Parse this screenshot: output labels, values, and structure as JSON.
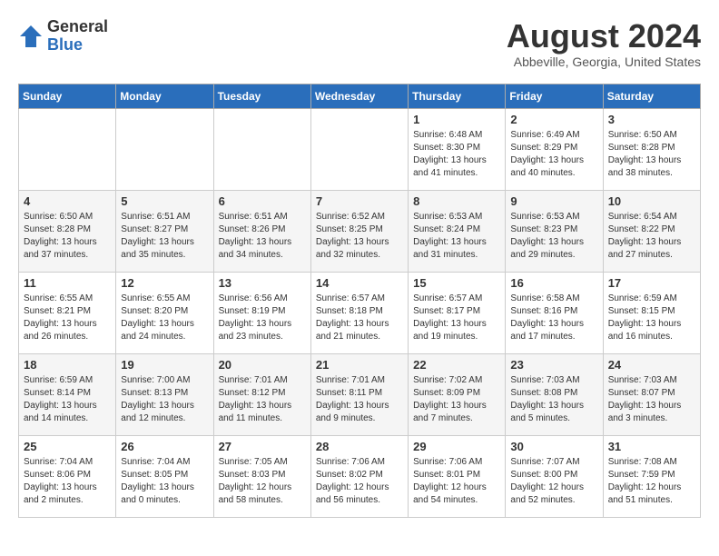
{
  "logo": {
    "general": "General",
    "blue": "Blue"
  },
  "title": "August 2024",
  "location": "Abbeville, Georgia, United States",
  "weekdays": [
    "Sunday",
    "Monday",
    "Tuesday",
    "Wednesday",
    "Thursday",
    "Friday",
    "Saturday"
  ],
  "weeks": [
    [
      {
        "day": "",
        "sunrise": "",
        "sunset": "",
        "daylight": ""
      },
      {
        "day": "",
        "sunrise": "",
        "sunset": "",
        "daylight": ""
      },
      {
        "day": "",
        "sunrise": "",
        "sunset": "",
        "daylight": ""
      },
      {
        "day": "",
        "sunrise": "",
        "sunset": "",
        "daylight": ""
      },
      {
        "day": "1",
        "sunrise": "Sunrise: 6:48 AM",
        "sunset": "Sunset: 8:30 PM",
        "daylight": "Daylight: 13 hours and 41 minutes."
      },
      {
        "day": "2",
        "sunrise": "Sunrise: 6:49 AM",
        "sunset": "Sunset: 8:29 PM",
        "daylight": "Daylight: 13 hours and 40 minutes."
      },
      {
        "day": "3",
        "sunrise": "Sunrise: 6:50 AM",
        "sunset": "Sunset: 8:28 PM",
        "daylight": "Daylight: 13 hours and 38 minutes."
      }
    ],
    [
      {
        "day": "4",
        "sunrise": "Sunrise: 6:50 AM",
        "sunset": "Sunset: 8:28 PM",
        "daylight": "Daylight: 13 hours and 37 minutes."
      },
      {
        "day": "5",
        "sunrise": "Sunrise: 6:51 AM",
        "sunset": "Sunset: 8:27 PM",
        "daylight": "Daylight: 13 hours and 35 minutes."
      },
      {
        "day": "6",
        "sunrise": "Sunrise: 6:51 AM",
        "sunset": "Sunset: 8:26 PM",
        "daylight": "Daylight: 13 hours and 34 minutes."
      },
      {
        "day": "7",
        "sunrise": "Sunrise: 6:52 AM",
        "sunset": "Sunset: 8:25 PM",
        "daylight": "Daylight: 13 hours and 32 minutes."
      },
      {
        "day": "8",
        "sunrise": "Sunrise: 6:53 AM",
        "sunset": "Sunset: 8:24 PM",
        "daylight": "Daylight: 13 hours and 31 minutes."
      },
      {
        "day": "9",
        "sunrise": "Sunrise: 6:53 AM",
        "sunset": "Sunset: 8:23 PM",
        "daylight": "Daylight: 13 hours and 29 minutes."
      },
      {
        "day": "10",
        "sunrise": "Sunrise: 6:54 AM",
        "sunset": "Sunset: 8:22 PM",
        "daylight": "Daylight: 13 hours and 27 minutes."
      }
    ],
    [
      {
        "day": "11",
        "sunrise": "Sunrise: 6:55 AM",
        "sunset": "Sunset: 8:21 PM",
        "daylight": "Daylight: 13 hours and 26 minutes."
      },
      {
        "day": "12",
        "sunrise": "Sunrise: 6:55 AM",
        "sunset": "Sunset: 8:20 PM",
        "daylight": "Daylight: 13 hours and 24 minutes."
      },
      {
        "day": "13",
        "sunrise": "Sunrise: 6:56 AM",
        "sunset": "Sunset: 8:19 PM",
        "daylight": "Daylight: 13 hours and 23 minutes."
      },
      {
        "day": "14",
        "sunrise": "Sunrise: 6:57 AM",
        "sunset": "Sunset: 8:18 PM",
        "daylight": "Daylight: 13 hours and 21 minutes."
      },
      {
        "day": "15",
        "sunrise": "Sunrise: 6:57 AM",
        "sunset": "Sunset: 8:17 PM",
        "daylight": "Daylight: 13 hours and 19 minutes."
      },
      {
        "day": "16",
        "sunrise": "Sunrise: 6:58 AM",
        "sunset": "Sunset: 8:16 PM",
        "daylight": "Daylight: 13 hours and 17 minutes."
      },
      {
        "day": "17",
        "sunrise": "Sunrise: 6:59 AM",
        "sunset": "Sunset: 8:15 PM",
        "daylight": "Daylight: 13 hours and 16 minutes."
      }
    ],
    [
      {
        "day": "18",
        "sunrise": "Sunrise: 6:59 AM",
        "sunset": "Sunset: 8:14 PM",
        "daylight": "Daylight: 13 hours and 14 minutes."
      },
      {
        "day": "19",
        "sunrise": "Sunrise: 7:00 AM",
        "sunset": "Sunset: 8:13 PM",
        "daylight": "Daylight: 13 hours and 12 minutes."
      },
      {
        "day": "20",
        "sunrise": "Sunrise: 7:01 AM",
        "sunset": "Sunset: 8:12 PM",
        "daylight": "Daylight: 13 hours and 11 minutes."
      },
      {
        "day": "21",
        "sunrise": "Sunrise: 7:01 AM",
        "sunset": "Sunset: 8:11 PM",
        "daylight": "Daylight: 13 hours and 9 minutes."
      },
      {
        "day": "22",
        "sunrise": "Sunrise: 7:02 AM",
        "sunset": "Sunset: 8:09 PM",
        "daylight": "Daylight: 13 hours and 7 minutes."
      },
      {
        "day": "23",
        "sunrise": "Sunrise: 7:03 AM",
        "sunset": "Sunset: 8:08 PM",
        "daylight": "Daylight: 13 hours and 5 minutes."
      },
      {
        "day": "24",
        "sunrise": "Sunrise: 7:03 AM",
        "sunset": "Sunset: 8:07 PM",
        "daylight": "Daylight: 13 hours and 3 minutes."
      }
    ],
    [
      {
        "day": "25",
        "sunrise": "Sunrise: 7:04 AM",
        "sunset": "Sunset: 8:06 PM",
        "daylight": "Daylight: 13 hours and 2 minutes."
      },
      {
        "day": "26",
        "sunrise": "Sunrise: 7:04 AM",
        "sunset": "Sunset: 8:05 PM",
        "daylight": "Daylight: 13 hours and 0 minutes."
      },
      {
        "day": "27",
        "sunrise": "Sunrise: 7:05 AM",
        "sunset": "Sunset: 8:03 PM",
        "daylight": "Daylight: 12 hours and 58 minutes."
      },
      {
        "day": "28",
        "sunrise": "Sunrise: 7:06 AM",
        "sunset": "Sunset: 8:02 PM",
        "daylight": "Daylight: 12 hours and 56 minutes."
      },
      {
        "day": "29",
        "sunrise": "Sunrise: 7:06 AM",
        "sunset": "Sunset: 8:01 PM",
        "daylight": "Daylight: 12 hours and 54 minutes."
      },
      {
        "day": "30",
        "sunrise": "Sunrise: 7:07 AM",
        "sunset": "Sunset: 8:00 PM",
        "daylight": "Daylight: 12 hours and 52 minutes."
      },
      {
        "day": "31",
        "sunrise": "Sunrise: 7:08 AM",
        "sunset": "Sunset: 7:59 PM",
        "daylight": "Daylight: 12 hours and 51 minutes."
      }
    ]
  ]
}
